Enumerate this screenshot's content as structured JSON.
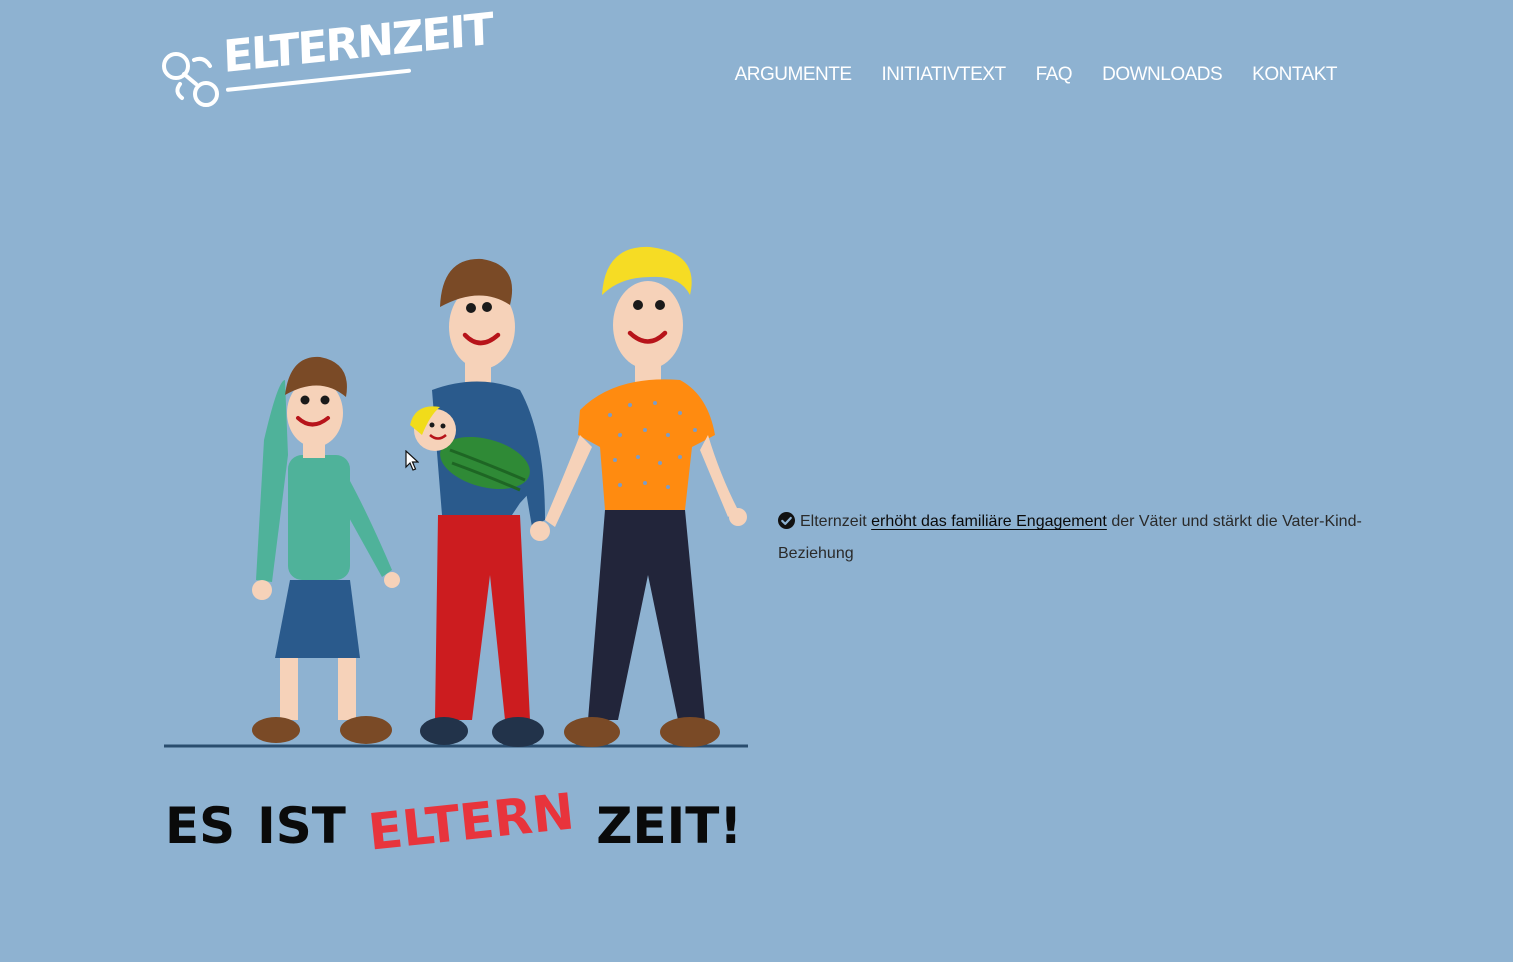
{
  "header": {
    "logo_text": "ELTERNZEIT",
    "nav": [
      "ARGUMENTE",
      "INITIATIVTEXT",
      "FAQ",
      "DOWNLOADS",
      "KONTAKT"
    ]
  },
  "hero": {
    "slogan": [
      "ES",
      "IST",
      "ELTERN",
      "ZEIT!"
    ],
    "slogan_accent_color": "#e8343c"
  },
  "argument": {
    "prefix": "Elternzeit",
    "link_text": "erhöht das familiäre Engagement",
    "suffix": "der Väter und stärkt die Vater-Kind-Beziehung",
    "icon": "check-circle-icon"
  },
  "colors": {
    "background": "#8eb2d1",
    "nav_text": "#ffffff"
  }
}
